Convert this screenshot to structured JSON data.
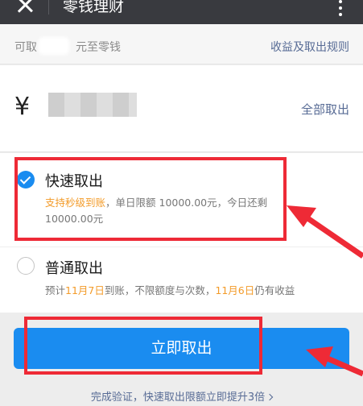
{
  "topbar": {
    "title": "零钱理财"
  },
  "info": {
    "hint_prefix": "可取",
    "hint_suffix": "元至零钱",
    "rules_link": "收益及取出规则"
  },
  "amount": {
    "currency": "¥",
    "withdraw_all": "全部取出"
  },
  "options": {
    "fast": {
      "name": "快速取出",
      "tag": "支持秒级到账",
      "desc": "，单日限额 10000.00元，今日还剩10000.00元",
      "selected": true
    },
    "normal": {
      "name": "普通取出",
      "desc_prefix": "预计",
      "date_arrive": "11月7日",
      "desc_mid": "到账，不限额度与次数，",
      "date_earn": "11月6日",
      "desc_suffix": "仍有收益",
      "selected": false
    }
  },
  "action": {
    "button_label": "立即取出"
  },
  "footer": {
    "link_text": "完成验证，快速取出限额立即提升3倍"
  },
  "colors": {
    "accent": "#1a8cf0",
    "highlight": "#ee2a36",
    "orange": "#f39b29",
    "link": "#576b95"
  },
  "icons": [
    "close-icon",
    "more-icon",
    "radio-checked-icon",
    "radio-unchecked-icon",
    "chevron-right-icon"
  ]
}
